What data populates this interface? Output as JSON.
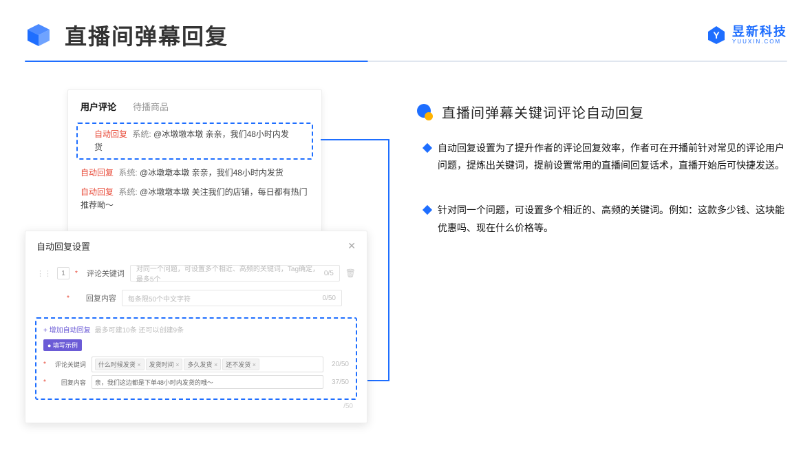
{
  "header": {
    "title": "直播间弹幕回复",
    "brand_name": "昱新科技",
    "brand_sub": "YUUXIN.COM"
  },
  "comments_card": {
    "tab_active": "用户评论",
    "tab_other": "待播商品",
    "row1_tag": "自动回复",
    "row1_sys": "系统:",
    "row1_text": "@冰墩墩本墩 亲亲，我们48小时内发货",
    "row2_tag": "自动回复",
    "row2_sys": "系统:",
    "row2_text": "@冰墩墩本墩 亲亲，我们48小时内发货",
    "row3_tag": "自动回复",
    "row3_sys": "系统:",
    "row3_text": "@冰墩墩本墩 关注我们的店铺，每日都有热门推荐呦～"
  },
  "settings": {
    "title": "自动回复设置",
    "index": "1",
    "label_keyword": "评论关键词",
    "ph_keyword": "对同一个问题，可设置多个相近、高频的关键词，Tag确定，最多5个",
    "count_keyword": "0/5",
    "label_reply": "回复内容",
    "ph_reply": "每条限50个中文字符",
    "count_reply": "0/50",
    "add_label": "+ 增加自动回复",
    "add_hint": "最多可建10条 还可以创建9条",
    "example_tag": "● 填写示例",
    "ex_label_kw": "评论关键词",
    "ex_tags": [
      "什么时候发货",
      "发货时间",
      "多久发货",
      "还不发货"
    ],
    "ex_count_kw": "20/50",
    "ex_label_reply": "回复内容",
    "ex_reply": "亲，我们这边都是下单48小时内发货的哦～",
    "ex_count_reply": "37/50",
    "outer_count": "/50"
  },
  "right": {
    "section_title": "直播间弹幕关键词评论自动回复",
    "bullets": [
      "自动回复设置为了提升作者的评论回复效率，作者可在开播前针对常见的评论用户问题，提炼出关键词，提前设置常用的直播间回复话术，直播开始后可快捷发送。",
      "针对同一个问题，可设置多个相近的、高频的关键词。例如：这款多少钱、这块能优惠吗、现在什么价格等。"
    ]
  }
}
